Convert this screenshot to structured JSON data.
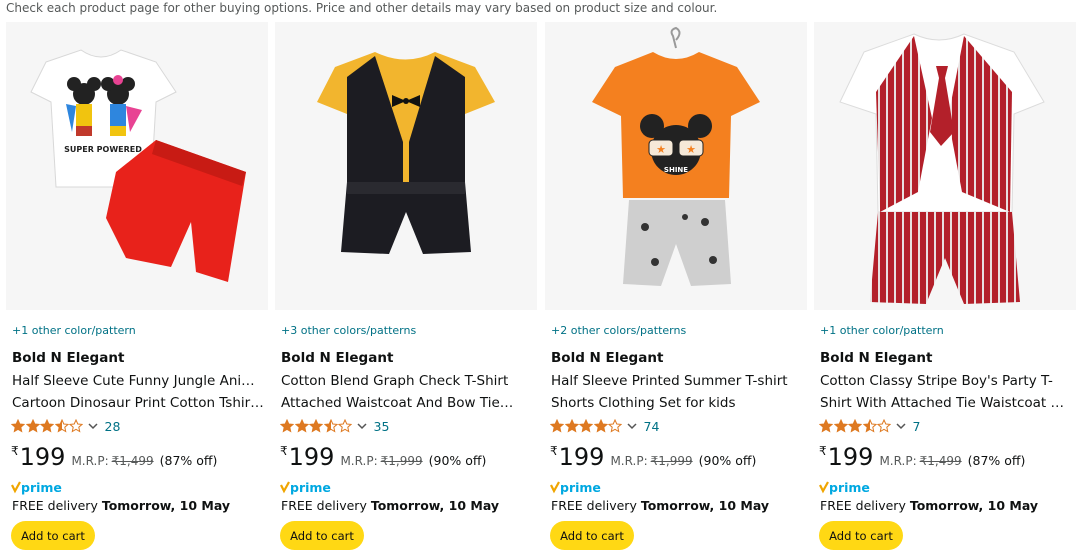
{
  "notice": "Check each product page for other buying options. Price and other details may vary based on product size and colour.",
  "colors": {
    "link": "#007185",
    "star": "#de7921",
    "button": "#ffd814",
    "prime": "#00a8e1"
  },
  "products": [
    {
      "swatch": "+1 other color/pattern",
      "brand": "Bold N Elegant",
      "title1": "Half Sleeve Cute Funny Jungle Animal",
      "title2": "Cartoon Dinosaur Print Cotton Tshir…",
      "rating": 3.5,
      "count": "28",
      "currency": "₹",
      "price": "199",
      "mrp_label": "M.R.P:",
      "mrp": "₹1,499",
      "off": "(87% off)",
      "prime": "prime",
      "delivery_prefix": "FREE delivery",
      "delivery_date": "Tomorrow, 10 May",
      "button": "Add to cart",
      "image_text": "SUPER POWERED",
      "image": "mickey-tshirt-red-shorts"
    },
    {
      "swatch": "+3 other colors/patterns",
      "brand": "Bold N Elegant",
      "title1": "Cotton Blend Graph Check T-Shirt",
      "title2": "Attached Waistcoat And Bow Tie…",
      "rating": 3.5,
      "count": "35",
      "currency": "₹",
      "price": "199",
      "mrp_label": "M.R.P:",
      "mrp": "₹1,999",
      "off": "(90% off)",
      "prime": "prime",
      "delivery_prefix": "FREE delivery",
      "delivery_date": "Tomorrow, 10 May",
      "button": "Add to cart",
      "image": "yellow-tshirt-black-waistcoat"
    },
    {
      "swatch": "+2 other colors/patterns",
      "brand": "Bold N Elegant",
      "title1": "Half Sleeve Printed Summer T-shirt",
      "title2": "Shorts Clothing Set for kids",
      "rating": 4.0,
      "count": "74",
      "currency": "₹",
      "price": "199",
      "mrp_label": "M.R.P:",
      "mrp": "₹1,999",
      "off": "(90% off)",
      "prime": "prime",
      "delivery_prefix": "FREE delivery",
      "delivery_date": "Tomorrow, 10 May",
      "button": "Add to cart",
      "image_text": "SHINE",
      "image": "orange-tshirt-grey-shorts"
    },
    {
      "swatch": "+1 other color/pattern",
      "brand": "Bold N Elegant",
      "title1": "Cotton Classy Stripe Boy's Party T-",
      "title2": "Shirt With Attached Tie Waistcoat &…",
      "rating": 3.5,
      "count": "7",
      "currency": "₹",
      "price": "199",
      "mrp_label": "M.R.P:",
      "mrp": "₹1,499",
      "off": "(87% off)",
      "prime": "prime",
      "delivery_prefix": "FREE delivery",
      "delivery_date": "Tomorrow, 10 May",
      "button": "Add to cart",
      "image": "red-stripe-waistcoat-tie"
    }
  ]
}
